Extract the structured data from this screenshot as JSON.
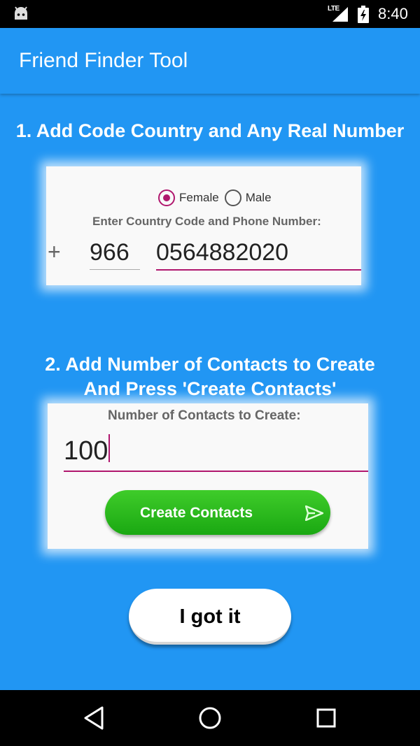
{
  "status_bar": {
    "time": "8:40",
    "network": "LTE",
    "icons": [
      "android-robot-icon",
      "lte-signal-icon",
      "battery-charging-icon"
    ]
  },
  "app_bar": {
    "title": "Friend Finder Tool"
  },
  "step1": {
    "text": "1. Add Code Country and Any Real Number",
    "gender_options": [
      "Female",
      "Male"
    ],
    "selected_gender": "Female",
    "hint": "Enter Country Code and Phone Number:",
    "plus": "+",
    "country_code": "966",
    "phone_number": "0564882020"
  },
  "step2": {
    "line1": "2. Add Number of Contacts to Create",
    "line2": "And Press 'Create Contacts'",
    "hint": "Number of Contacts to Create:",
    "count": "100",
    "create_button": "Create Contacts"
  },
  "got_it_button": "I got it",
  "nav_bar": {
    "icons": [
      "back-icon",
      "home-icon",
      "recents-icon"
    ]
  },
  "colors": {
    "primary": "#2196F3",
    "accent": "#b0176e",
    "button_green": "#2bbb1e"
  }
}
